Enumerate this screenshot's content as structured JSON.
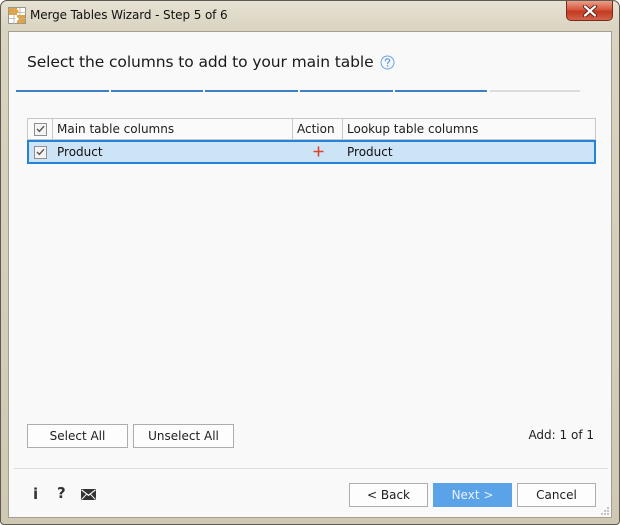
{
  "window": {
    "title": "Merge Tables Wizard - Step 5 of 6",
    "app_icon": "puzzle-table-icon",
    "close_icon": "close-icon"
  },
  "header": {
    "heading": "Select the columns to add to your main table",
    "help_icon": "help-circle-icon",
    "progress": {
      "total_steps": 6,
      "current_step": 5,
      "completed_steps": 5
    }
  },
  "grid": {
    "columns": [
      {
        "label": ""
      },
      {
        "label": "Main table columns"
      },
      {
        "label": "Action"
      },
      {
        "label": "Lookup table columns"
      }
    ],
    "header_checked": true,
    "rows": [
      {
        "checked": true,
        "main_column": "Product",
        "action": "+",
        "action_icon": "plus-icon",
        "lookup_column": "Product",
        "selected": true
      }
    ]
  },
  "buttons": {
    "select_all": "Select All",
    "unselect_all": "Unselect All",
    "back": "< Back",
    "next": "Next >",
    "cancel": "Cancel"
  },
  "status": {
    "add_count": "Add: 1 of 1"
  },
  "footer_icons": {
    "info": "i",
    "help": "?",
    "mail": "mail-icon"
  },
  "colors": {
    "accent": "#3f7fc4",
    "selection_bg": "#cde4f7",
    "selection_border": "#2383d6",
    "primary_button": "#5aa3e8",
    "action_plus": "#d9452b",
    "close_button": "#c9442a"
  }
}
